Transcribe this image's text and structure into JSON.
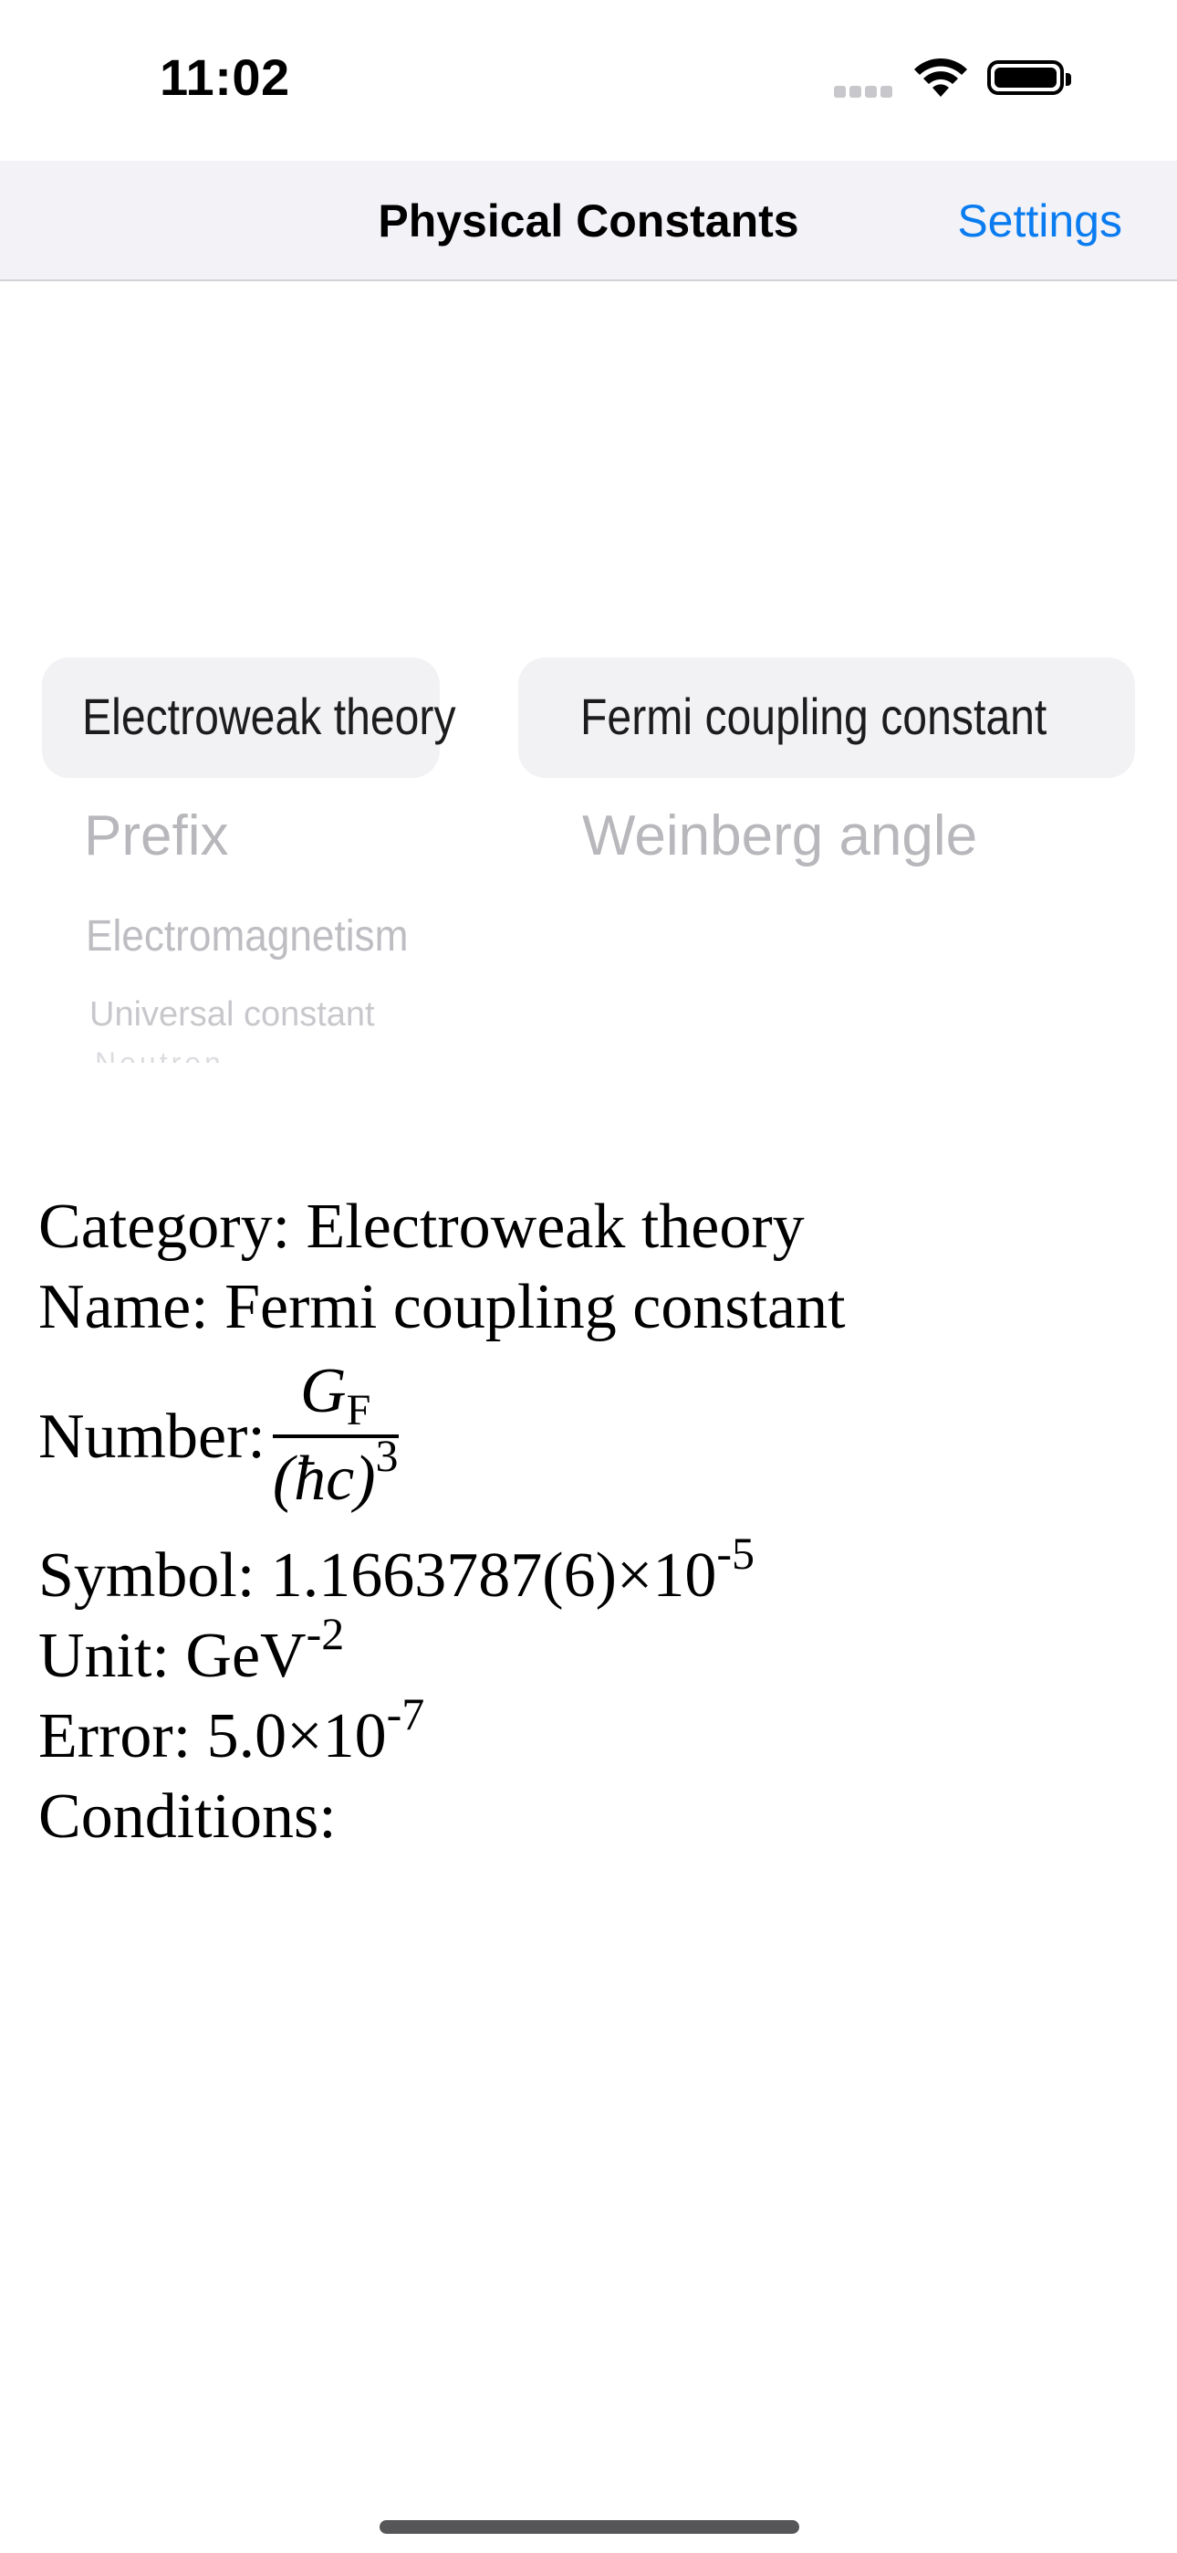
{
  "status_bar": {
    "time": "11:02"
  },
  "nav": {
    "title": "Physical Constants",
    "settings_label": "Settings"
  },
  "picker": {
    "left_column": {
      "selected": "Electroweak theory",
      "below": [
        "Prefix",
        "Electromagnetism",
        "Universal constant",
        "Neutron"
      ]
    },
    "right_column": {
      "selected": "Fermi coupling constant",
      "below": [
        "Weinberg angle"
      ]
    }
  },
  "details": {
    "category_label": "Category:",
    "category_value": "Electroweak theory",
    "name_label": "Name:",
    "name_value": "Fermi coupling constant",
    "number_label": "Number:",
    "number_formula": {
      "numerator": "G",
      "numerator_sub": "F",
      "denominator": "(ħc)",
      "denominator_exp": "3"
    },
    "symbol_label": "Symbol:",
    "symbol_value": "1.1663787(6)×10",
    "symbol_exp": "-5",
    "unit_label": "Unit:",
    "unit_value": "GeV",
    "unit_exp": "-2",
    "error_label": "Error:",
    "error_value": "5.0×10",
    "error_exp": "-7",
    "conditions_label": "Conditions:",
    "conditions_value": ""
  }
}
